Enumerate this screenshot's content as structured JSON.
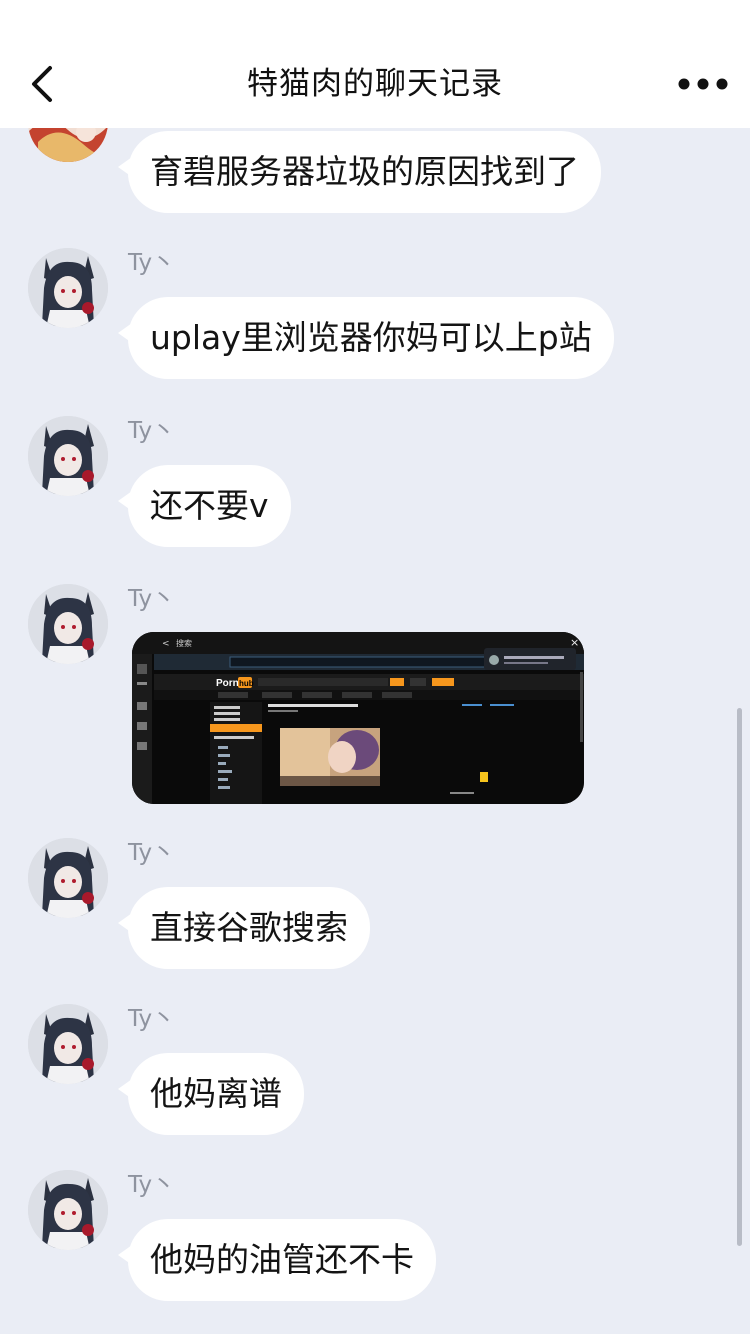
{
  "header": {
    "title": "特猫肉的聊天记录",
    "back_icon": "chevron-left-icon",
    "more_icon": "more-dots-icon"
  },
  "messages": [
    {
      "sender": "",
      "text": "育碧服务器垃圾的原因找到了"
    },
    {
      "sender": "Ty丶",
      "text": "uplay里浏览器你妈可以上p站"
    },
    {
      "sender": "Ty丶",
      "text": "还不要v"
    },
    {
      "sender": "Ty丶",
      "image": "browser-screenshot",
      "image_brand": [
        "Porn",
        "hub"
      ],
      "image_caption": "搜索"
    },
    {
      "sender": "Ty丶",
      "text": "直接谷歌搜索"
    },
    {
      "sender": "Ty丶",
      "text": "他妈离谱"
    },
    {
      "sender": "Ty丶",
      "text": "他妈的油管还不卡"
    }
  ],
  "colors": {
    "background": "#eaedf5",
    "bubble": "#ffffff",
    "header": "#ffffff",
    "brand_orange": "#f7971d"
  }
}
